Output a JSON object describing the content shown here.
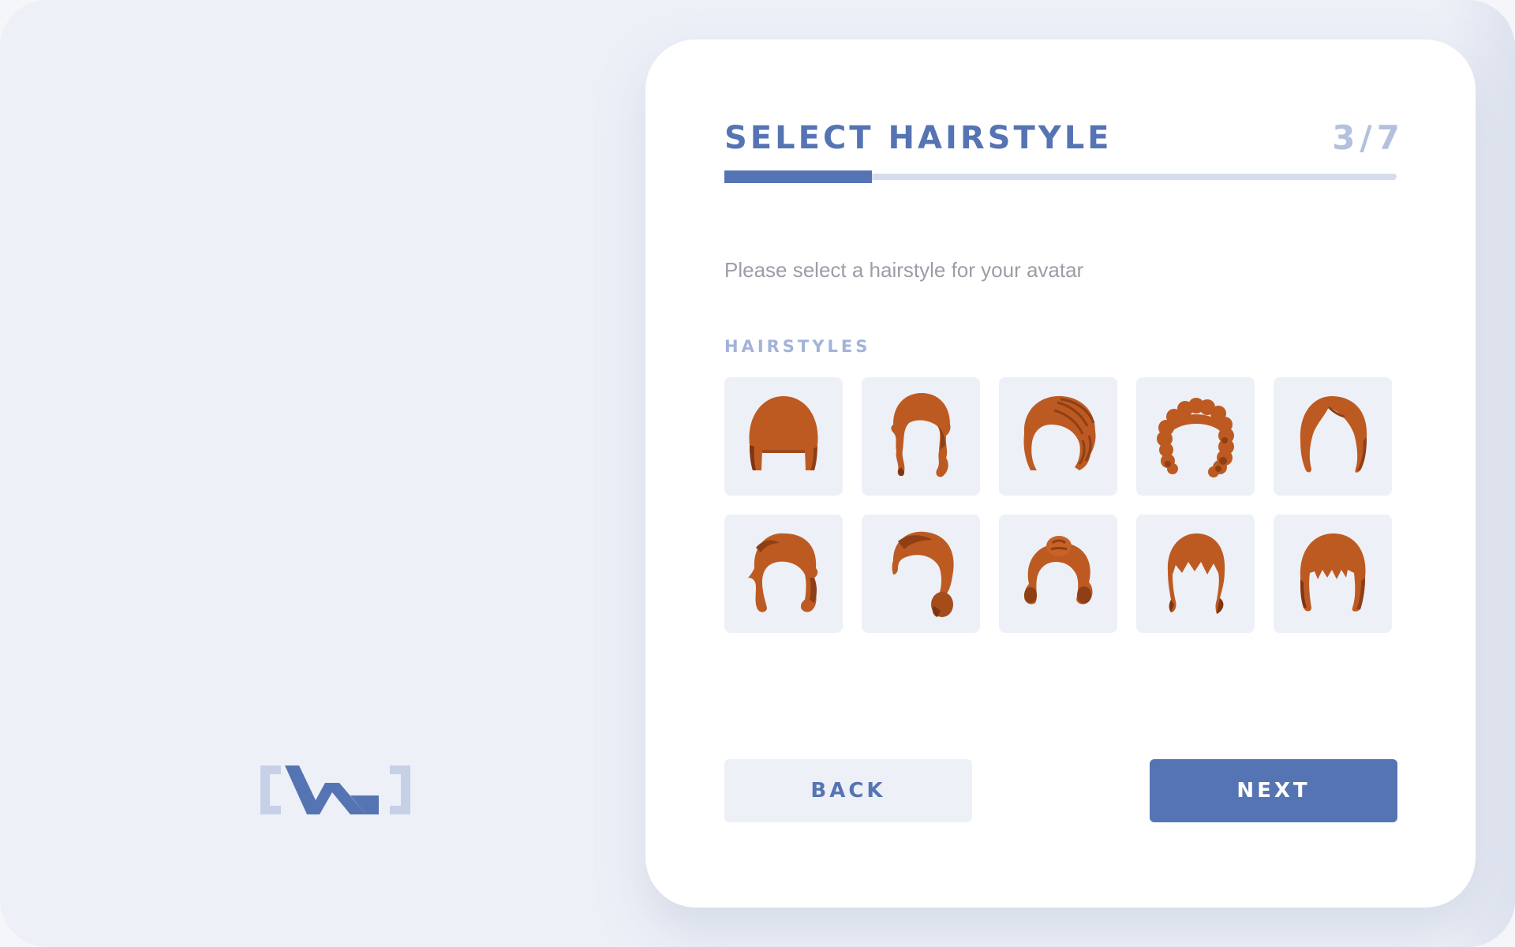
{
  "brand": {
    "logo_label": "[VA]",
    "logo_icon": "va-bracket-logo",
    "colors": {
      "primary": "#5574b3",
      "primary_light": "#b3c1de",
      "hair": "#bd5a22",
      "hair_dark": "#7d3512"
    }
  },
  "header": {
    "title": "SELECT HAIRSTYLE",
    "step": "3/7",
    "progress": 0.22
  },
  "subtitle": "Please select a hairstyle for your avatar",
  "section_label": "HAIRSTYLES",
  "hairstyles": [
    {
      "icon": "hair-bob-bangs-icon"
    },
    {
      "icon": "hair-wavy-shoulder-icon"
    },
    {
      "icon": "hair-braided-side-icon"
    },
    {
      "icon": "hair-curly-afro-icon"
    },
    {
      "icon": "hair-side-part-long-icon"
    },
    {
      "icon": "hair-retro-curl-icon"
    },
    {
      "icon": "hair-side-swept-bun-icon"
    },
    {
      "icon": "hair-pin-curls-icon"
    },
    {
      "icon": "hair-bangs-flip-icon"
    },
    {
      "icon": "hair-blunt-fringe-icon"
    }
  ],
  "buttons": {
    "back": "BACK",
    "next": "NEXT"
  }
}
